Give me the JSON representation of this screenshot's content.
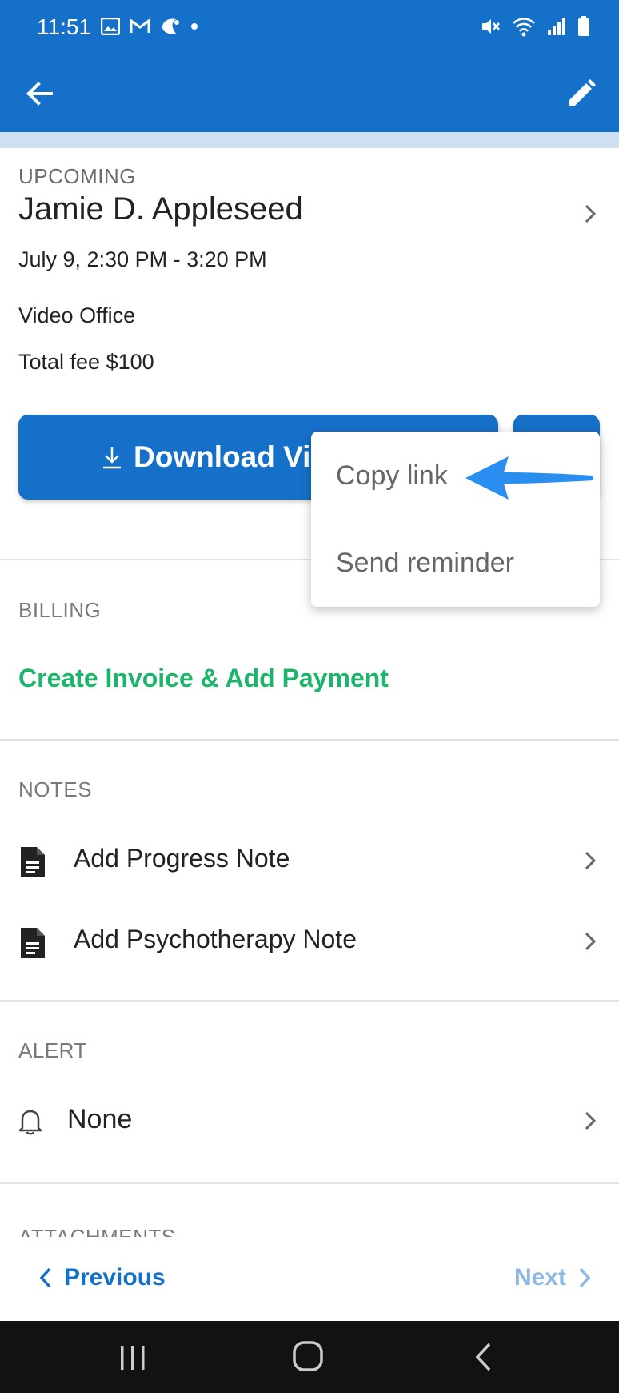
{
  "status_bar": {
    "time": "11:51",
    "left_icons": [
      "gallery-icon",
      "gmail-icon",
      "app-icon",
      "dot-icon"
    ],
    "right_icons": [
      "mute-icon",
      "wifi-icon",
      "signal-icon",
      "battery-icon"
    ]
  },
  "app_bar": {
    "back_icon": "arrow-left-icon",
    "edit_icon": "pencil-icon"
  },
  "appointment": {
    "status": "UPCOMING",
    "client_name": "Jamie D. Appleseed",
    "time_range": "July 9, 2:30 PM - 3:20 PM",
    "location": "Video Office",
    "fee": "Total fee $100"
  },
  "actions": {
    "download_label": "Download Vic",
    "download_icon": "download-icon"
  },
  "popup_menu": {
    "items": [
      "Copy link",
      "Send reminder"
    ]
  },
  "billing": {
    "label": "BILLING",
    "link": "Create Invoice & Add Payment"
  },
  "notes": {
    "label": "NOTES",
    "items": [
      "Add Progress Note",
      "Add Psychotherapy Note"
    ]
  },
  "alert": {
    "label": "ALERT",
    "value": "None"
  },
  "attachments": {
    "label": "ATTACHMENTS"
  },
  "bottom_nav": {
    "previous": "Previous",
    "next": "Next"
  },
  "colors": {
    "primary": "#1570c9",
    "link_green": "#1db56b",
    "arrow_blue": "#2a8ef0",
    "disabled_blue": "#8db8e2"
  }
}
